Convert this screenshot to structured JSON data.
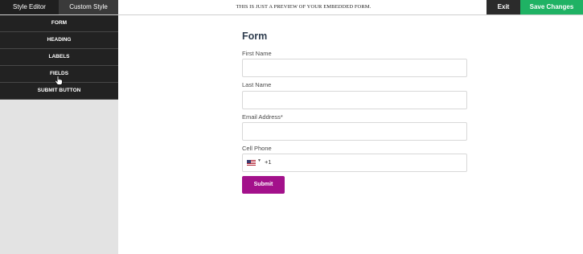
{
  "header": {
    "tabs": [
      {
        "label": "Style Editor"
      },
      {
        "label": "Custom Style"
      }
    ],
    "preview_note": "THIS IS JUST A PREVIEW OF YOUR EMBEDDED FORM.",
    "exit_label": "Exit",
    "save_label": "Save Changes"
  },
  "sidebar": {
    "items": [
      {
        "label": "FORM"
      },
      {
        "label": "HEADING"
      },
      {
        "label": "LABELS"
      },
      {
        "label": "FIELDS"
      },
      {
        "label": "SUBMIT BUTTON"
      }
    ]
  },
  "form": {
    "title": "Form",
    "fields": [
      {
        "label": "First Name",
        "value": ""
      },
      {
        "label": "Last Name",
        "value": ""
      },
      {
        "label": "Email Address*",
        "value": ""
      },
      {
        "label": "Cell Phone",
        "country": "US",
        "dial_code": "+1"
      }
    ],
    "submit_label": "Submit"
  },
  "colors": {
    "save_button": "#1fb264",
    "submit_button": "#a3118b",
    "sidebar_item": "#222222"
  }
}
